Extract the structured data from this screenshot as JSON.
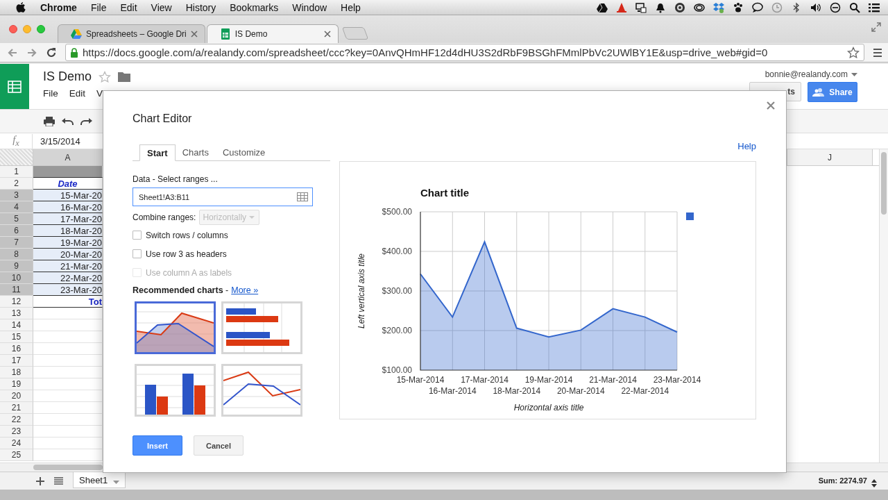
{
  "menubar": {
    "app": "Chrome",
    "items": [
      "File",
      "Edit",
      "View",
      "History",
      "Bookmarks",
      "Window",
      "Help"
    ]
  },
  "browser": {
    "tabs": [
      {
        "title": "Spreadsheets – Google Dri",
        "kind": "drive",
        "selected": false
      },
      {
        "title": "IS Demo",
        "kind": "sheets",
        "selected": true
      }
    ],
    "url": "https://docs.google.com/a/realandy.com/spreadsheet/ccc?key=0AnvQHmHF12d4dHU3S2dRbF9BSGhFMmlPbVc2UWlBY1E&usp=drive_web#gid=0"
  },
  "doc": {
    "title": "IS Demo",
    "menu": [
      "File",
      "Edit",
      "V"
    ],
    "account": "bonnie@realandy.com",
    "comments_button": "ts",
    "share_button": "Share"
  },
  "formula_bar": {
    "label": "f$_{x}$",
    "value": "3/15/2014"
  },
  "sheet": {
    "columns": [
      "A",
      "J"
    ],
    "rows": [
      {
        "number": "1",
        "kind": "band",
        "selected": false
      },
      {
        "number": "2",
        "kind": "header",
        "value": "Date",
        "selected": false
      },
      {
        "number": "3",
        "kind": "data",
        "value": "15-Mar-20",
        "selected": true
      },
      {
        "number": "4",
        "kind": "data",
        "value": "16-Mar-20",
        "selected": true
      },
      {
        "number": "5",
        "kind": "data",
        "value": "17-Mar-20",
        "selected": true
      },
      {
        "number": "6",
        "kind": "data",
        "value": "18-Mar-20",
        "selected": true
      },
      {
        "number": "7",
        "kind": "data",
        "value": "19-Mar-20",
        "selected": true
      },
      {
        "number": "8",
        "kind": "data",
        "value": "20-Mar-20",
        "selected": true
      },
      {
        "number": "9",
        "kind": "data",
        "value": "21-Mar-20",
        "selected": true
      },
      {
        "number": "10",
        "kind": "data",
        "value": "22-Mar-20",
        "selected": true
      },
      {
        "number": "11",
        "kind": "data",
        "value": "23-Mar-20",
        "selected": true
      },
      {
        "number": "12",
        "kind": "total",
        "value": "Tot",
        "selected": false
      },
      {
        "number": "13",
        "kind": "empty",
        "selected": false
      },
      {
        "number": "14",
        "kind": "empty",
        "selected": false
      },
      {
        "number": "15",
        "kind": "empty",
        "selected": false
      },
      {
        "number": "16",
        "kind": "empty",
        "selected": false
      },
      {
        "number": "17",
        "kind": "empty",
        "selected": false
      },
      {
        "number": "18",
        "kind": "empty",
        "selected": false
      },
      {
        "number": "19",
        "kind": "empty",
        "selected": false
      },
      {
        "number": "20",
        "kind": "empty",
        "selected": false
      },
      {
        "number": "21",
        "kind": "empty",
        "selected": false
      },
      {
        "number": "22",
        "kind": "empty",
        "selected": false
      },
      {
        "number": "23",
        "kind": "empty",
        "selected": false
      },
      {
        "number": "24",
        "kind": "empty",
        "selected": false
      },
      {
        "number": "25",
        "kind": "empty",
        "selected": false
      }
    ]
  },
  "footer": {
    "sheet_tabs": [
      {
        "label": "Sheet1",
        "selected": true
      }
    ],
    "sum": "Sum: 2274.97"
  },
  "chart_editor": {
    "title": "Chart Editor",
    "tabs": [
      {
        "label": "Start",
        "selected": true
      },
      {
        "label": "Charts",
        "selected": false
      },
      {
        "label": "Customize",
        "selected": false
      }
    ],
    "help": "Help",
    "data_label": "Data - Select ranges ...",
    "range": "Sheet1!A3:B11",
    "combine_label": "Combine ranges:",
    "combine": {
      "value": "Horizontally",
      "disabled": true
    },
    "options": [
      {
        "label": "Switch rows / columns",
        "checked": false,
        "disabled": false
      },
      {
        "label": "Use row 3 as headers",
        "checked": false,
        "disabled": false
      },
      {
        "label": "Use column A as labels",
        "checked": false,
        "disabled": true
      }
    ],
    "recommended": {
      "text": "**Recommended charts** -",
      "link": "More »"
    },
    "thumbnails": [
      {
        "kind": "area",
        "selected": true
      },
      {
        "kind": "bar",
        "selected": false
      },
      {
        "kind": "column",
        "selected": false
      },
      {
        "kind": "line",
        "selected": false
      }
    ],
    "buttons": [
      {
        "label": "Insert",
        "kind": "primary"
      },
      {
        "label": "Cancel",
        "kind": "secondary"
      }
    ],
    "chart_data": {
      "type": "area",
      "title": "Chart title",
      "xlabel": "Horizontal axis title",
      "ylabel": "Left vertical axis title",
      "categories": [
        "15-Mar-2014",
        "16-Mar-2014",
        "17-Mar-2014",
        "18-Mar-2014",
        "19-Mar-2014",
        "20-Mar-2014",
        "21-Mar-2014",
        "22-Mar-2014",
        "23-Mar-2014"
      ],
      "series": [
        {
          "color": "#3366cc",
          "values": [
            343,
            234,
            424,
            206,
            184,
            201,
            255,
            234,
            196
          ]
        }
      ],
      "grid": true,
      "ylim": [
        100,
        500
      ],
      "yticks": [
        {
          "value": 100,
          "label": "$100.00"
        },
        {
          "value": 200,
          "label": "$200.00"
        },
        {
          "value": 300,
          "label": "$300.00"
        },
        {
          "value": 400,
          "label": "$400.00"
        },
        {
          "value": 500,
          "label": "$500.00"
        }
      ]
    }
  }
}
